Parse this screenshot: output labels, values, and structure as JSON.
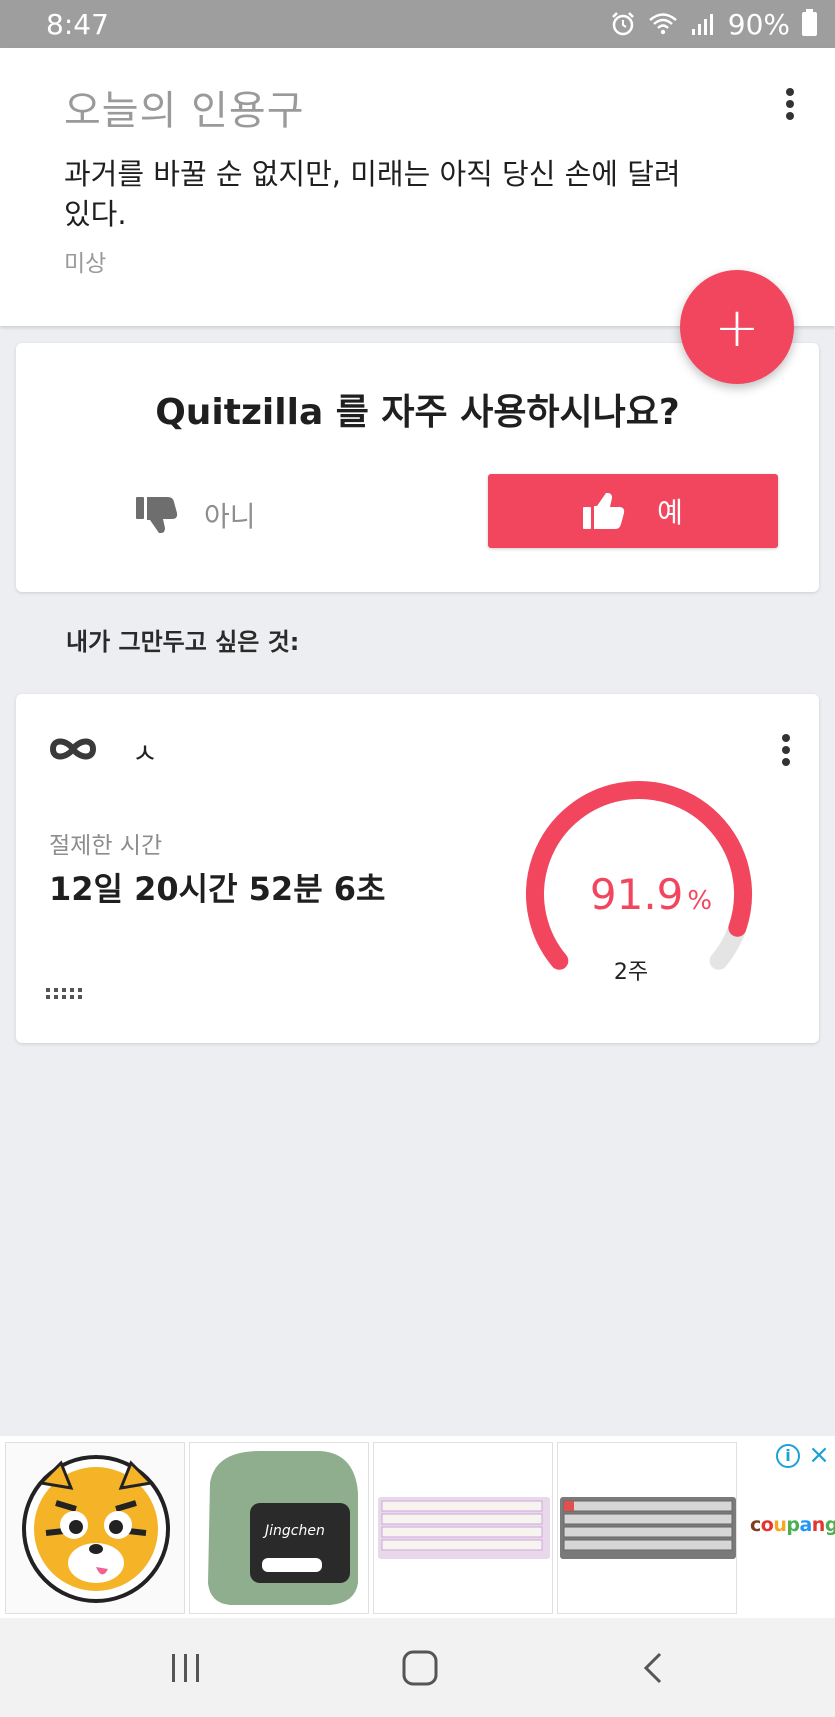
{
  "status_bar": {
    "time": "8:47",
    "battery": "90%",
    "icons": [
      "alarm-icon",
      "wifi-icon",
      "signal-icon",
      "battery-icon"
    ]
  },
  "quote": {
    "title": "오늘의 인용구",
    "text": "과거를 바꿀 순 없지만, 미래는 아직 당신 손에 달려 있다.",
    "author": "미상"
  },
  "fab": {
    "label": "+"
  },
  "rate_prompt": {
    "question": "Quitzilla 를 자주 사용하시나요?",
    "no_label": "아니",
    "yes_label": "예"
  },
  "section": {
    "label": "내가 그만두고 싶은 것:"
  },
  "habit": {
    "name": "ㅅ",
    "icon": "infinity-icon",
    "abstinence_label": "절제한 시간",
    "abstinence_value": "12일 20시간 52분 6초",
    "progress_value": "91.9",
    "progress_unit": "%",
    "progress_fraction": 0.919,
    "goal_label": "2주"
  },
  "ad": {
    "brand": "coupang",
    "items": [
      "tiger-sticker",
      "label-printer",
      "pastel-keyboard",
      "gray-keyboard"
    ]
  },
  "colors": {
    "accent": "#f2465f",
    "status_bar": "#9e9e9e",
    "background": "#eceef1"
  }
}
